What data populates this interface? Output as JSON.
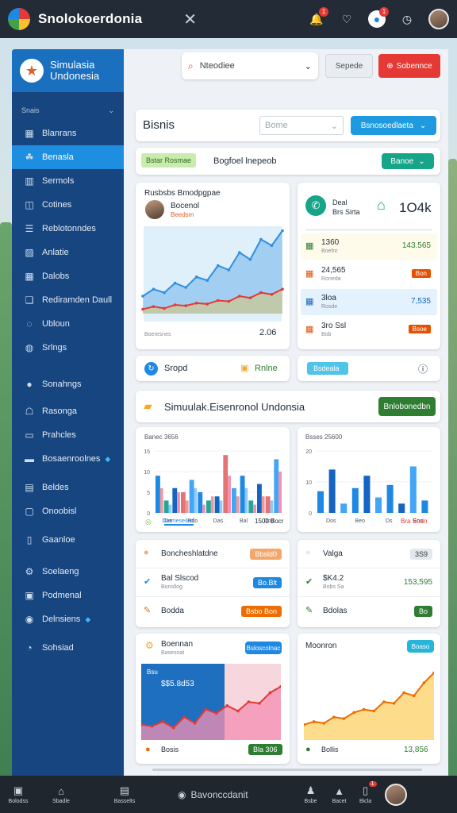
{
  "app": {
    "title": "Snolokoerdonia"
  },
  "topbar": {
    "notif_badge": "1",
    "chat_badge": "1"
  },
  "sidebar": {
    "brand_line1": "Simulasia",
    "brand_line2": "Undonesia",
    "section": "Snais",
    "items": [
      {
        "label": "Blanrans",
        "icon": "building-icon"
      },
      {
        "label": "Benasla",
        "icon": "people-icon",
        "active": true
      },
      {
        "label": "Sermols",
        "icon": "chart-icon"
      },
      {
        "label": "Cotines",
        "icon": "cart-icon"
      },
      {
        "label": "Reblotonndes",
        "icon": "list-icon"
      },
      {
        "label": "Anlatie",
        "icon": "image-icon"
      },
      {
        "label": "Dalobs",
        "icon": "calendar-icon"
      },
      {
        "label": "Rediramden Daull",
        "icon": "doc-icon"
      },
      {
        "label": "Ubloun",
        "icon": "chat-icon"
      },
      {
        "label": "Srlngs",
        "icon": "settings-icon"
      },
      {
        "label": "Sonahngs",
        "icon": "globe-icon"
      },
      {
        "label": "Rasonga",
        "icon": "user-icon"
      },
      {
        "label": "Prahcles",
        "icon": "tag-icon"
      },
      {
        "label": "Bosaenroolnes",
        "icon": "folder-icon"
      },
      {
        "label": "Beldes",
        "icon": "table-icon"
      },
      {
        "label": "Onoobisl",
        "icon": "map-icon"
      },
      {
        "label": "Gaanloe",
        "icon": "file-icon"
      },
      {
        "label": "Soelaeng",
        "icon": "gear-icon"
      },
      {
        "label": "Podmenal",
        "icon": "box-icon"
      },
      {
        "label": "Delnsiens",
        "icon": "pin-icon"
      },
      {
        "label": "Sohsiad",
        "icon": "help-icon"
      }
    ]
  },
  "header": {
    "search_value": "Nteodiee",
    "btn_secondary": "Sepede",
    "btn_primary": "Sobennce"
  },
  "business": {
    "title": "Bisnis",
    "filter_value": "Bome",
    "action": "Bsnosoedlaeta",
    "tag": "Bstar Rosmae",
    "subtitle": "Bogfoel lnepeob",
    "mini_btn": "Banoe"
  },
  "growth_card": {
    "title": "Rusbsbs Bmodpgpae",
    "name": "Bocenol",
    "sub": "Beedsm",
    "value": "2.06",
    "footer": "Boeresnes"
  },
  "stats_card": {
    "head_line1": "Deal",
    "head_line2": "Brs Sirta",
    "value": "1O4k",
    "rows": [
      {
        "label": "1360",
        "sub": "Boefnr",
        "value": "143.565",
        "color": "#2e7d32"
      },
      {
        "label": "24,565",
        "sub": "Roneda",
        "value": "Bon",
        "color": "#e65100"
      },
      {
        "label": "3loa",
        "sub": "Rosde",
        "value": "7,535",
        "color": "#1565c0"
      },
      {
        "label": "3ro Ssl",
        "sub": "Bob",
        "value": "Bsoe",
        "color": "#e65100"
      }
    ]
  },
  "row_actions": {
    "left": "Sropd",
    "left_tag": "Rnlne",
    "right_tag": "Bsdeala"
  },
  "section2": {
    "title": "Simuulak.Eisenronol Undonsia",
    "button": "Bnlobonedbn"
  },
  "bar_left": {
    "title": "Banec 3656",
    "y_ticks": [
      "15",
      "10",
      "5",
      "0"
    ],
    "x_labels": [
      "Dae",
      "Bdo",
      "Das",
      "Bal",
      "Dod"
    ],
    "legend": "Dameseilnd",
    "value": "1500 Bocr"
  },
  "bar_right": {
    "title": "Bsses 25600",
    "y_ticks": [
      "20",
      "10",
      "0"
    ],
    "x_labels": [
      "Dos",
      "Beo",
      "Ds",
      "Ens"
    ],
    "value": "Bra Sodn"
  },
  "list_left": {
    "items": [
      {
        "title": "Boncheshlatdne",
        "badge": "Bbsld0",
        "badge_color": "#f4a76b"
      },
      {
        "title": "Bal Slscod",
        "sub": "Bonsllog",
        "badge": "Bo.Blt",
        "badge_color": "#1e88e5"
      },
      {
        "title": "Bodda",
        "badge": "Bsbo Bon",
        "badge_color": "#ef6c00"
      }
    ]
  },
  "list_right": {
    "items": [
      {
        "title": "Valga",
        "badge": "3S9",
        "badge_color": "#e3e8ef"
      },
      {
        "title": "$K4.2",
        "sub": "Bobs Sa",
        "value": "153,595",
        "color": "#2e7d32"
      },
      {
        "title": "Bdolas",
        "badge": "Bo",
        "badge_color": "#2e7d32"
      }
    ]
  },
  "area_left": {
    "title": "Boennan",
    "sub": "Basesoat",
    "btn": "Bsloscolnac",
    "overlay_title": "Bsu",
    "overlay_value": "$$5.8d53",
    "footer": "Bosis",
    "footer_badge": "Bla 306"
  },
  "area_right": {
    "title": "Moonron",
    "btn": "Boaso",
    "footer": "Bollis",
    "footer_value": "13,856"
  },
  "bottombar": {
    "items": [
      "Bolodss",
      "Sbadle",
      "Basselts"
    ],
    "center": "Bavonccdanit",
    "right_items": [
      "Bsbe",
      "Bacet",
      "Bicla"
    ],
    "badge": "1"
  },
  "colors": {
    "primary": "#1e8fe0",
    "sidebar": "#17457f",
    "danger": "#e53935",
    "success": "#2e7d32"
  },
  "chart_data": [
    {
      "type": "area",
      "title": "Rusbsbs Bmodpgpae",
      "series": [
        {
          "values": [
            20,
            28,
            24,
            35,
            30,
            42,
            38,
            55,
            50,
            70,
            62,
            85,
            78,
            95
          ]
        },
        {
          "values": [
            5,
            8,
            6,
            10,
            9,
            12,
            11,
            15,
            14,
            20,
            18,
            24,
            22,
            28
          ]
        }
      ]
    },
    {
      "type": "bar",
      "title": "Banec 3656",
      "categories": [
        "Dae",
        "Bdo",
        "Das",
        "Bal",
        "Dod"
      ],
      "y_ticks": [
        "15",
        "10",
        "5",
        "0"
      ],
      "series": [
        {
          "values": [
            9,
            3,
            6,
            5,
            8,
            5,
            3,
            4,
            14,
            6,
            9,
            3,
            7,
            4,
            13
          ]
        },
        {
          "values": [
            6,
            2,
            5,
            3,
            6,
            2,
            4,
            3,
            9,
            4,
            6,
            2,
            4,
            3,
            10
          ]
        }
      ]
    },
    {
      "type": "bar",
      "title": "Bsses 25600",
      "categories": [
        "Dos",
        "Beo",
        "Ds",
        "Ens"
      ],
      "y_ticks": [
        "20",
        "10",
        "0"
      ],
      "series": [
        {
          "values": [
            7,
            14,
            3,
            8,
            12,
            5,
            9,
            3,
            15,
            4
          ]
        }
      ]
    },
    {
      "type": "area",
      "title": "Boennan",
      "series": [
        {
          "values": [
            20,
            18,
            24,
            16,
            30,
            22,
            40,
            35,
            45,
            38,
            50,
            48,
            62,
            70
          ]
        }
      ]
    },
    {
      "type": "area",
      "title": "Moonron",
      "series": [
        {
          "values": [
            20,
            24,
            22,
            30,
            28,
            36,
            40,
            38,
            50,
            48,
            62,
            58,
            75,
            88
          ]
        }
      ]
    }
  ]
}
